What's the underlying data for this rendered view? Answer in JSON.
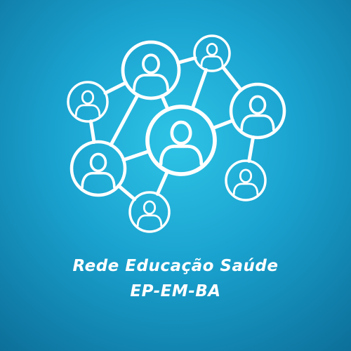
{
  "graphic": {
    "icon": "people-network-icon",
    "line_color": "#ffffff",
    "background_center": "#2ec4e6",
    "background_edge": "#0c6f99"
  },
  "caption": {
    "line1": "Rede Educação Saúde",
    "line2": "EP-EM-BA"
  }
}
